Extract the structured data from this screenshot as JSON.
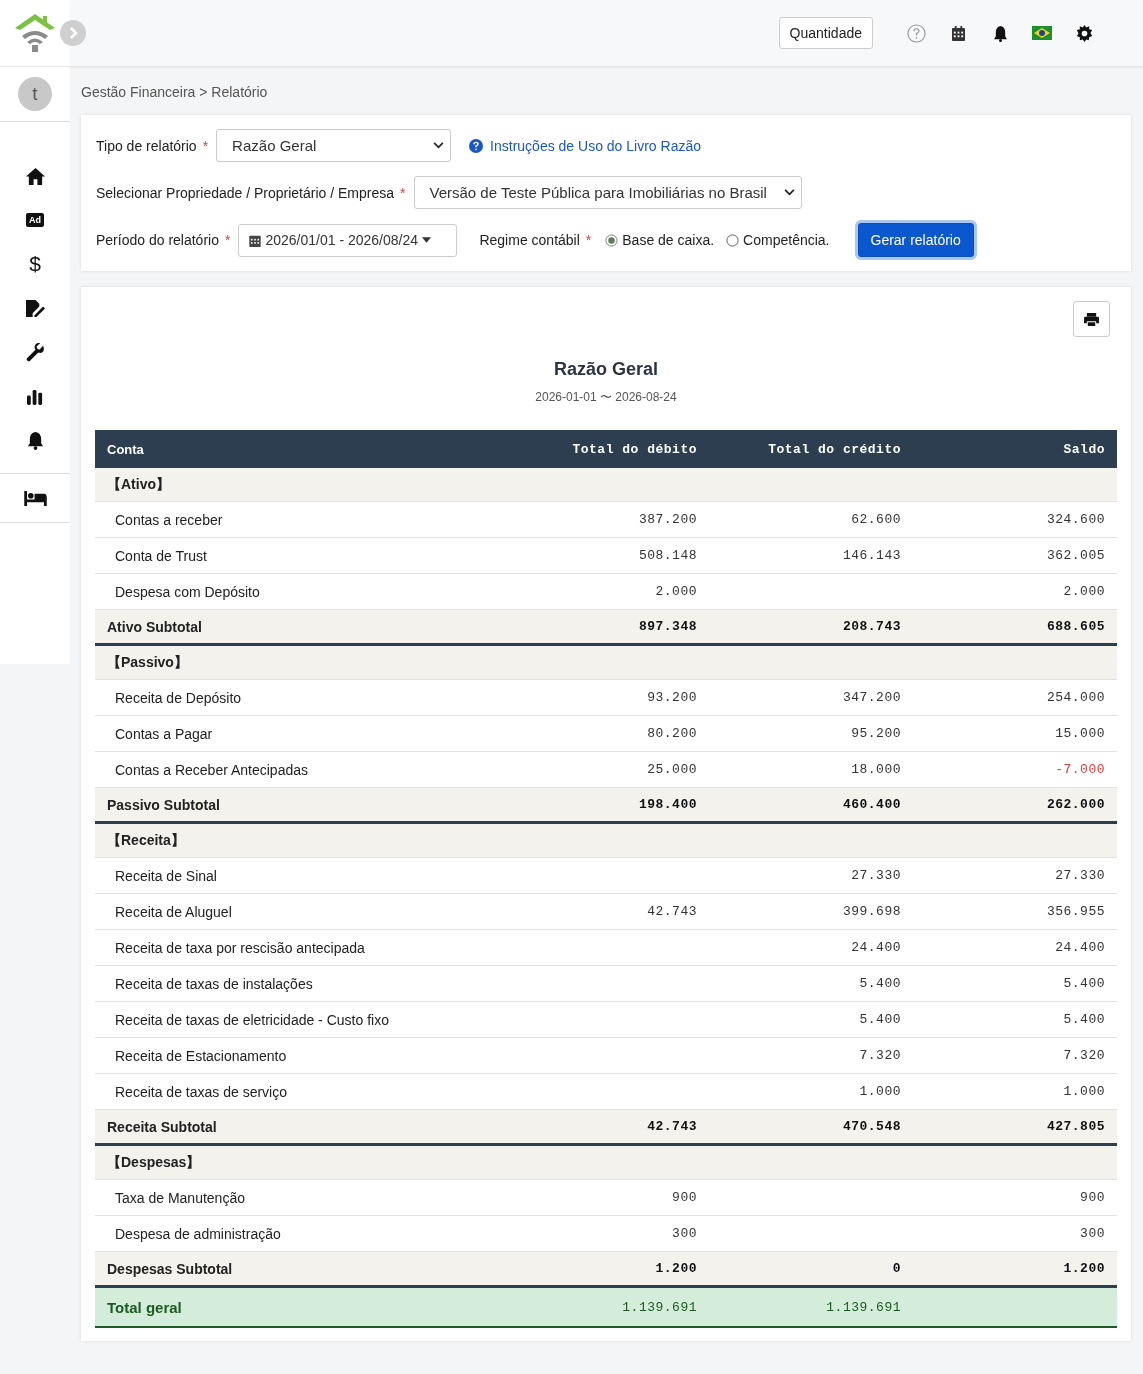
{
  "sidebar": {
    "avatar": "t",
    "ad_label": "Ad",
    "dollar_label": "$"
  },
  "topbar": {
    "quantity_button": "Quantidade"
  },
  "breadcrumb": "Gestão Financeira > Relatório",
  "filters": {
    "report_type": {
      "label": "Tipo de relatório",
      "marker": "*",
      "value": "Razão Geral"
    },
    "help_link": "Instruções de Uso do Livro Razão",
    "property": {
      "label": "Selecionar Propriedade / Proprietário / Empresa",
      "marker": "*",
      "value": "Versão de Teste Pública para Imobiliárias no Brasil"
    },
    "period": {
      "label": "Período do relatório",
      "marker": "*",
      "value": "2026/01/01 - 2026/08/24"
    },
    "regime": {
      "label": "Regime contábil",
      "marker": "*",
      "options": [
        {
          "label": "Base de caixa.",
          "selected": true
        },
        {
          "label": "Competência.",
          "selected": false
        }
      ]
    },
    "generate_button": "Gerar relatório"
  },
  "report": {
    "title": "Razão Geral",
    "period": "2026-01-01 〜 2026-08-24",
    "columns": [
      "Conta",
      "Total do débito",
      "Total do crédito",
      "Saldo"
    ],
    "sections": [
      {
        "header": "【Ativo】",
        "rows": [
          {
            "account": "Contas a receber",
            "debit": "387.200",
            "credit": "62.600",
            "balance": "324.600",
            "negative": false
          },
          {
            "account": "Conta de Trust",
            "debit": "508.148",
            "credit": "146.143",
            "balance": "362.005",
            "negative": false
          },
          {
            "account": "Despesa com Depósito",
            "debit": "2.000",
            "balance": "2.000",
            "negative": false
          }
        ],
        "subtotal": {
          "label": "Ativo Subtotal",
          "debit": "897.348",
          "credit": "208.743",
          "balance": "688.605"
        }
      },
      {
        "header": "【Passivo】",
        "rows": [
          {
            "account": "Receita de Depósito",
            "debit": "93.200",
            "credit": "347.200",
            "balance": "254.000",
            "negative": false
          },
          {
            "account": "Contas a Pagar",
            "debit": "80.200",
            "credit": "95.200",
            "balance": "15.000",
            "negative": false
          },
          {
            "account": "Contas a Receber Antecipadas",
            "debit": "25.000",
            "credit": "18.000",
            "balance": "-7.000",
            "negative": true
          }
        ],
        "subtotal": {
          "label": "Passivo Subtotal",
          "debit": "198.400",
          "credit": "460.400",
          "balance": "262.000"
        }
      },
      {
        "header": "【Receita】",
        "rows": [
          {
            "account": "Receita de Sinal",
            "credit": "27.330",
            "balance": "27.330",
            "negative": false
          },
          {
            "account": "Receita de Aluguel",
            "debit": "42.743",
            "credit": "399.698",
            "balance": "356.955",
            "negative": false
          },
          {
            "account": "Receita de taxa por rescisão antecipada",
            "credit": "24.400",
            "balance": "24.400",
            "negative": false
          },
          {
            "account": "Receita de taxas de instalações",
            "credit": "5.400",
            "balance": "5.400",
            "negative": false
          },
          {
            "account": "Receita de taxas de eletricidade - Custo fixo",
            "credit": "5.400",
            "balance": "5.400",
            "negative": false
          },
          {
            "account": "Receita de Estacionamento",
            "credit": "7.320",
            "balance": "7.320",
            "negative": false
          },
          {
            "account": "Receita de taxas de serviço",
            "credit": "1.000",
            "balance": "1.000",
            "negative": false
          }
        ],
        "subtotal": {
          "label": "Receita Subtotal",
          "debit": "42.743",
          "credit": "470.548",
          "balance": "427.805"
        }
      },
      {
        "header": "【Despesas】",
        "rows": [
          {
            "account": "Taxa de Manutenção",
            "debit": "900",
            "balance": "900",
            "negative": false
          },
          {
            "account": "Despesa de administração",
            "debit": "300",
            "balance": "300",
            "negative": false
          }
        ],
        "subtotal": {
          "label": "Despesas Subtotal",
          "debit": "1.200",
          "credit": "0",
          "balance": "1.200"
        }
      }
    ],
    "total": {
      "label": "Total geral",
      "debit": "1.139.691",
      "credit": "1.139.691"
    }
  }
}
